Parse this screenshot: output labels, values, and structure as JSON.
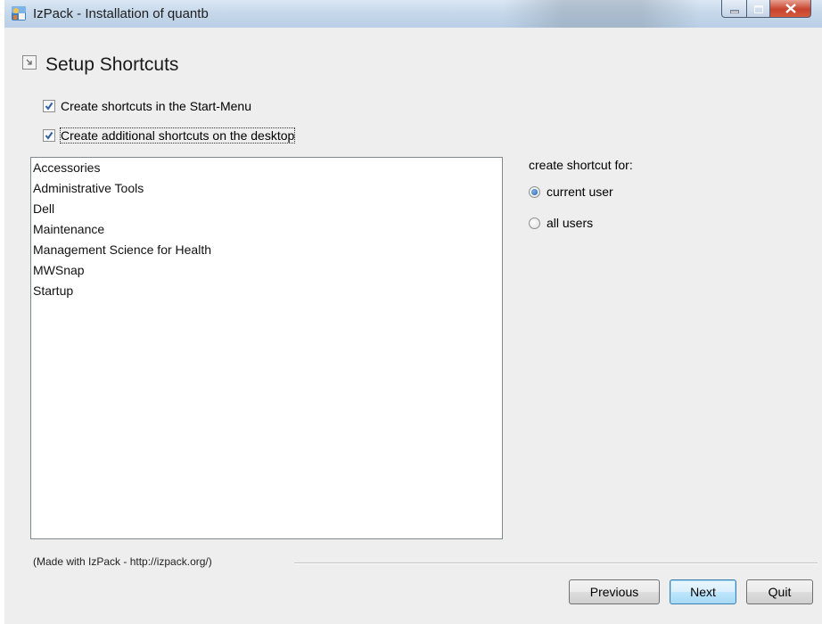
{
  "window": {
    "title": "IzPack - Installation of quantb",
    "controls": {
      "minimize_icon": "minimize-icon",
      "maximize_icon": "maximize-icon",
      "close_icon": "close-icon"
    }
  },
  "panel": {
    "title": "Setup Shortcuts",
    "header_icon": "shortcut-icon"
  },
  "options": {
    "start_menu": {
      "label": "Create shortcuts in the Start-Menu",
      "checked": true
    },
    "desktop": {
      "label": "Create additional shortcuts on the desktop",
      "checked": true
    }
  },
  "program_groups": [
    "Accessories",
    "Administrative Tools",
    "Dell",
    "Maintenance",
    "Management Science for Health",
    "MWSnap",
    "Startup"
  ],
  "scope": {
    "label": "create shortcut for:",
    "options": [
      {
        "label": "current user",
        "selected": true
      },
      {
        "label": "all users",
        "selected": false
      }
    ]
  },
  "footer": {
    "caption": "(Made with IzPack - http://izpack.org/)",
    "previous": "Previous",
    "next": "Next",
    "quit": "Quit"
  },
  "colors": {
    "accent": "#1f5fa8",
    "titlebar": "#c6d8ea",
    "background": "#eeeeee",
    "close_button": "#c7432d"
  }
}
